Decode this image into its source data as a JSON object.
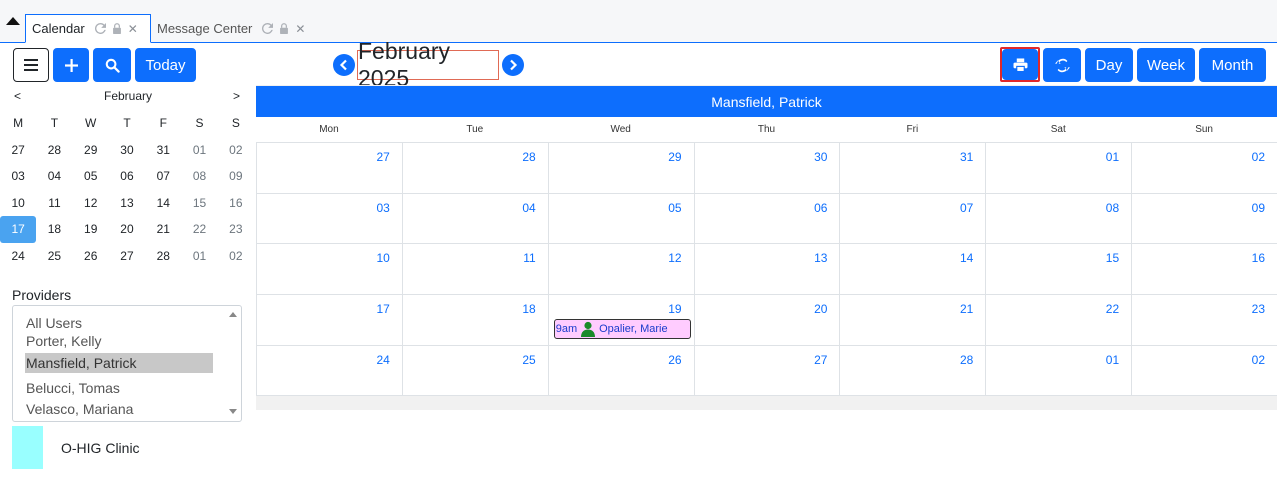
{
  "tabs": [
    {
      "label": "Calendar",
      "active": true
    },
    {
      "label": "Message Center",
      "active": false
    }
  ],
  "toolbar": {
    "today_label": "Today",
    "day_label": "Day",
    "week_label": "Week",
    "month_label": "Month",
    "icons": [
      "menu-icon",
      "plus-icon",
      "search-icon",
      "print-icon",
      "refresh-icon"
    ]
  },
  "header": {
    "month_title": "February 2025"
  },
  "mini_calendar": {
    "prev": "<",
    "next": ">",
    "month": "February",
    "weekdays": [
      "M",
      "T",
      "W",
      "T",
      "F",
      "S",
      "S"
    ],
    "weeks": [
      [
        "27",
        "28",
        "29",
        "30",
        "31",
        "01",
        "02"
      ],
      [
        "03",
        "04",
        "05",
        "06",
        "07",
        "08",
        "09"
      ],
      [
        "10",
        "11",
        "12",
        "13",
        "14",
        "15",
        "16"
      ],
      [
        "17",
        "18",
        "19",
        "20",
        "21",
        "22",
        "23"
      ],
      [
        "24",
        "25",
        "26",
        "27",
        "28",
        "01",
        "02"
      ]
    ],
    "selected": "17"
  },
  "providers": {
    "label": "Providers",
    "items": [
      "All Users",
      "Porter, Kelly",
      "Mansfield, Patrick",
      "Belucci, Tomas",
      "Velasco, Mariana"
    ],
    "selected": "Mansfield, Patrick"
  },
  "legend": {
    "label": "O-HIG Clinic",
    "color": "#99ffff"
  },
  "calendar": {
    "provider": "Mansfield, Patrick",
    "weekdays": [
      "Mon",
      "Tue",
      "Wed",
      "Thu",
      "Fri",
      "Sat",
      "Sun"
    ],
    "weeks": [
      [
        "27",
        "28",
        "29",
        "30",
        "31",
        "01",
        "02"
      ],
      [
        "03",
        "04",
        "05",
        "06",
        "07",
        "08",
        "09"
      ],
      [
        "10",
        "11",
        "12",
        "13",
        "14",
        "15",
        "16"
      ],
      [
        "17",
        "18",
        "19",
        "20",
        "21",
        "22",
        "23"
      ],
      [
        "24",
        "25",
        "26",
        "27",
        "28",
        "01",
        "02"
      ]
    ],
    "event": {
      "time": "9am",
      "patient": "Opalier, Marie",
      "color": "#ffccff"
    }
  },
  "colors": {
    "accent": "#0d6efd",
    "selected_day": "#4aa3f0",
    "focus_outline": "#e0282b"
  }
}
